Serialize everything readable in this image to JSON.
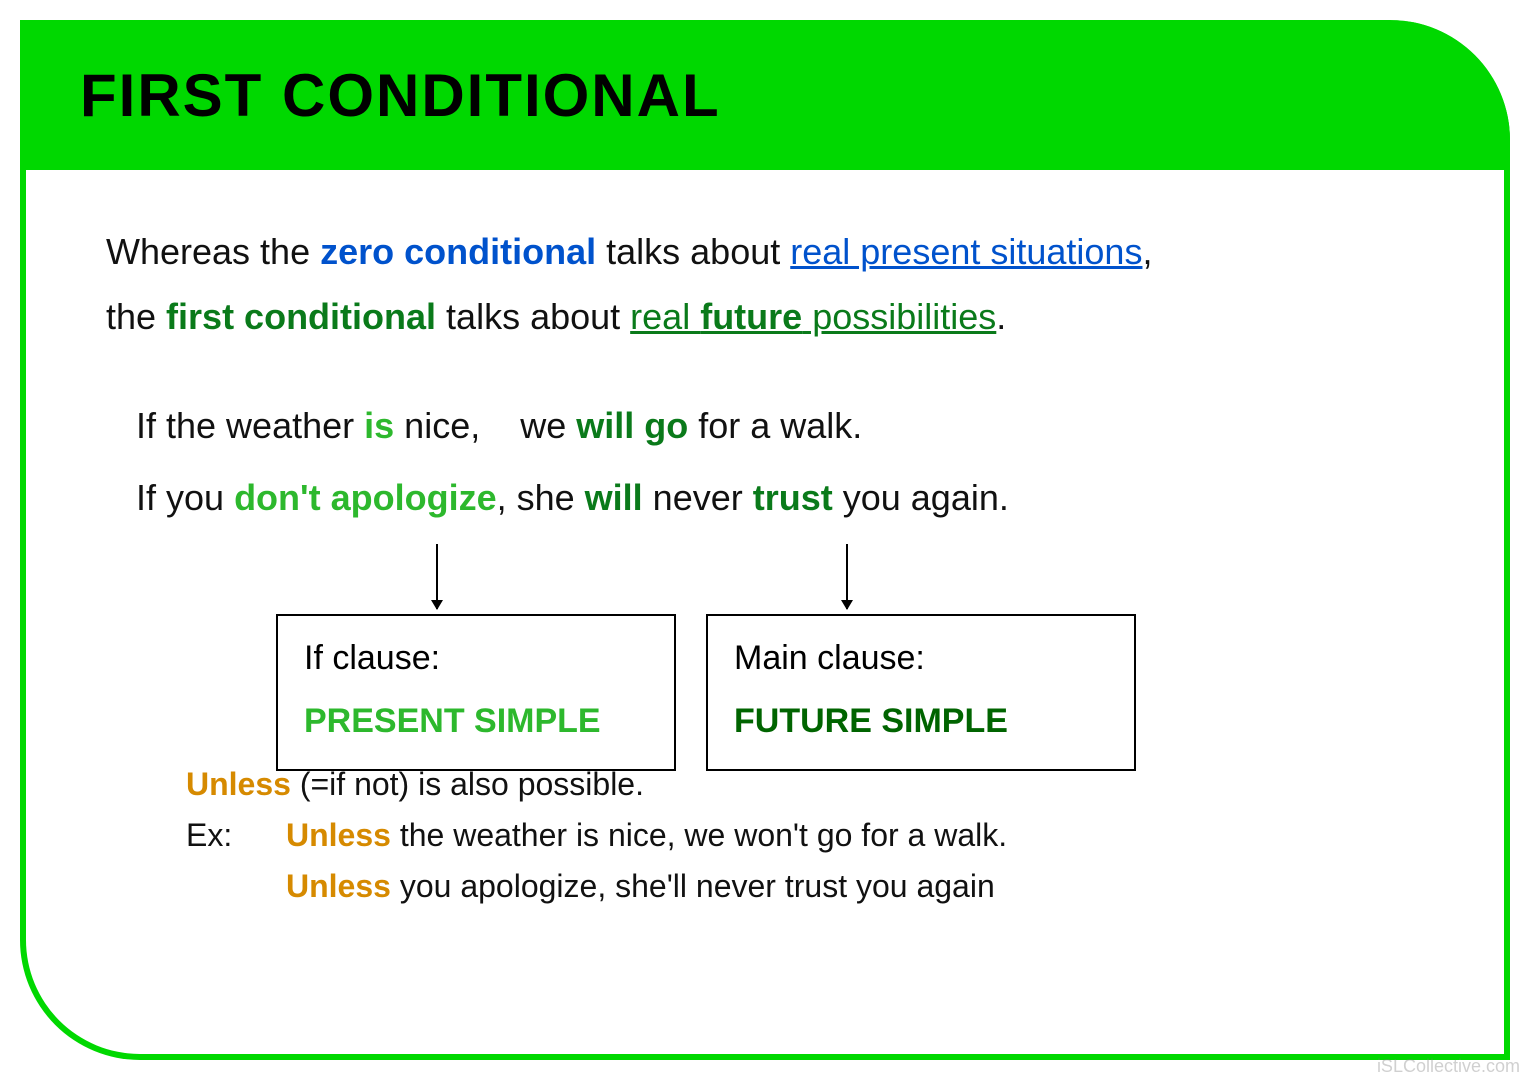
{
  "title": "FIRST CONDITIONAL",
  "intro": {
    "line1_a": "Whereas the ",
    "zero_cond": "zero conditional",
    "line1_b": " talks about ",
    "real_present": "real present situations",
    "line1_c": ",",
    "line2_a": "the ",
    "first_cond": "first conditional",
    "line2_b": " talks about ",
    "real": "real ",
    "future": "future",
    "possibilities": " possibilities",
    "line2_c": "."
  },
  "ex1": {
    "a": "If the weather ",
    "is": "is",
    "b": " nice,",
    "c": "we ",
    "willgo": "will go",
    "d": " for a walk."
  },
  "ex2": {
    "a": "If you ",
    "dont": "don't apologize",
    "b": ", she ",
    "will": "will",
    "c": " never ",
    "trust": "trust",
    "d": " you again."
  },
  "box1": {
    "label": "If clause:",
    "tense": "PRESENT SIMPLE"
  },
  "box2": {
    "label": "Main clause:",
    "tense": "FUTURE SIMPLE"
  },
  "unless": {
    "line1_a": "Unless",
    "line1_b": " (=if not) is also possible.",
    "ex_label": "Ex:",
    "ex1_a": "Unless",
    "ex1_b": " the weather is nice, we won't go for a walk.",
    "ex2_a": "Unless",
    "ex2_b": " you apologize, she'll never trust you again"
  },
  "watermark": "iSLCollective.com"
}
